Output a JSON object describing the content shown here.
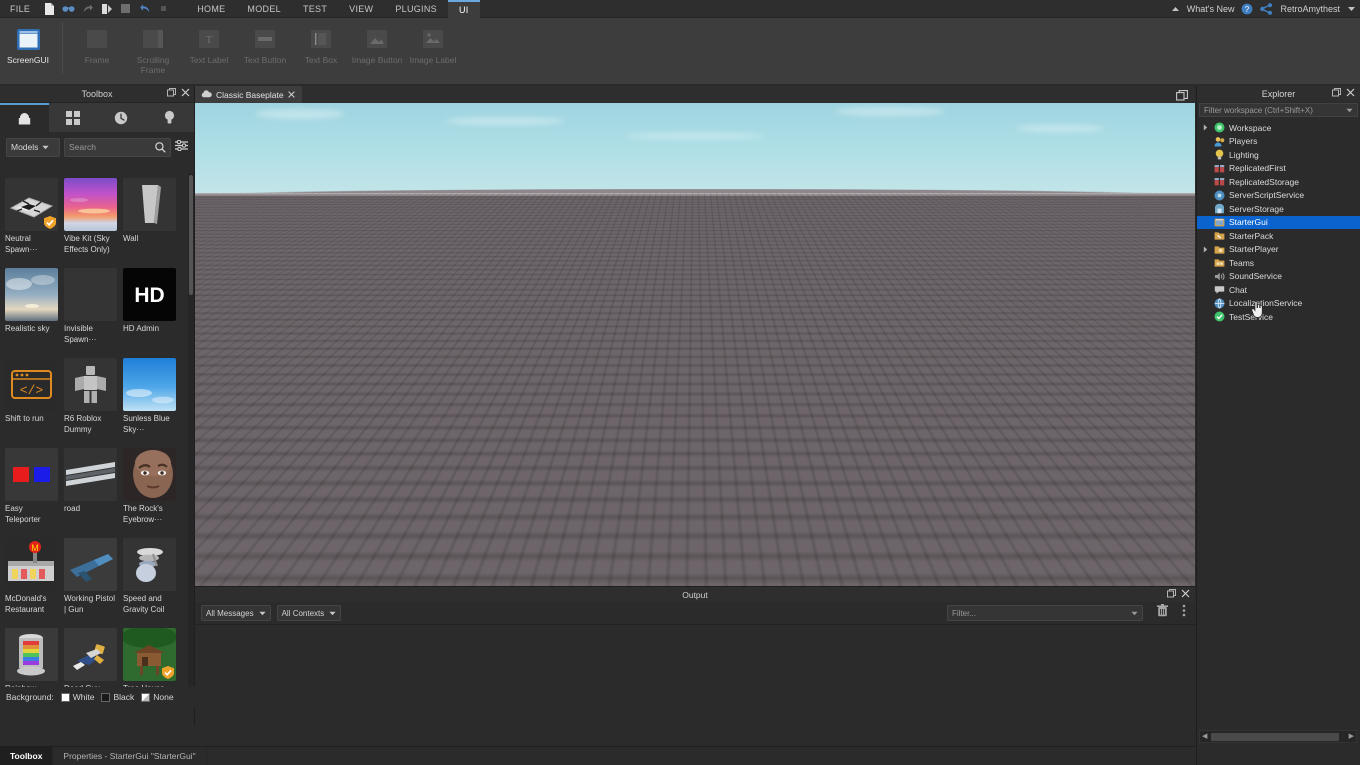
{
  "app": {
    "menu_file": "FILE",
    "ribbon_tabs": [
      {
        "label": "HOME",
        "active": false
      },
      {
        "label": "MODEL",
        "active": false
      },
      {
        "label": "TEST",
        "active": false
      },
      {
        "label": "VIEW",
        "active": false
      },
      {
        "label": "PLUGINS",
        "active": false
      },
      {
        "label": "UI",
        "active": true
      }
    ],
    "quick_access": [
      "new-file-icon",
      "find-icon",
      "redo-arrow-icon",
      "run-icon",
      "stop-icon",
      "undo-icon",
      "overflow-icon"
    ],
    "topright": {
      "collapse_icon": "chevron-up-icon",
      "whats_new": "What's New",
      "help_icon": "help-circle-icon",
      "share_icon": "share-icon",
      "username": "RetroAmythest",
      "dropdown_icon": "chevron-down-icon"
    }
  },
  "ribbon": {
    "items": [
      {
        "label": "ScreenGUI",
        "icon": "screengui-icon",
        "enabled": true
      },
      {
        "label": "Frame",
        "icon": "frame-icon",
        "enabled": false
      },
      {
        "label": "Scrolling Frame",
        "icon": "scrolling-frame-icon",
        "enabled": false
      },
      {
        "label": "Text Label",
        "icon": "text-label-icon",
        "enabled": false
      },
      {
        "label": "Text Button",
        "icon": "text-button-icon",
        "enabled": false
      },
      {
        "label": "Text Box",
        "icon": "text-box-icon",
        "enabled": false
      },
      {
        "label": "Image Button",
        "icon": "image-button-icon",
        "enabled": false
      },
      {
        "label": "Image Label",
        "icon": "image-label-icon",
        "enabled": false
      }
    ]
  },
  "toolbox": {
    "title": "Toolbox",
    "tabs": [
      {
        "icon": "marketplace-icon",
        "active": true
      },
      {
        "icon": "grid-icon",
        "active": false
      },
      {
        "icon": "clock-icon",
        "active": false
      },
      {
        "icon": "lightbulb-icon",
        "active": false
      }
    ],
    "category": "Models",
    "search_placeholder": "Search",
    "items": [
      {
        "name": "Neutral Spawn···",
        "thumb": "spawn-pad",
        "verified": true
      },
      {
        "name": "Vibe Kit (Sky Effects Only)",
        "thumb": "sunset-sky",
        "verified": false
      },
      {
        "name": "Wall",
        "thumb": "gray-wall",
        "verified": false
      },
      {
        "name": "Realistic sky",
        "thumb": "cloud-sky",
        "verified": false
      },
      {
        "name": "Invisible Spawn···",
        "thumb": "blank",
        "verified": false
      },
      {
        "name": "HD Admin",
        "thumb": "hd-logo",
        "verified": false
      },
      {
        "name": "Shift to run",
        "thumb": "code-window",
        "verified": false
      },
      {
        "name": "R6 Roblox Dummy",
        "thumb": "dummy-figure",
        "verified": false
      },
      {
        "name": "Sunless Blue Sky···",
        "thumb": "blue-sky",
        "verified": false
      },
      {
        "name": "Easy Teleporter",
        "thumb": "two-pads",
        "verified": false
      },
      {
        "name": "road",
        "thumb": "road-strip",
        "verified": false
      },
      {
        "name": "The Rock's Eyebrow···",
        "thumb": "face-photo",
        "verified": false
      },
      {
        "name": "McDonald's Restaurant",
        "thumb": "mcdonalds-build",
        "verified": false
      },
      {
        "name": "Working Pistol | Gun",
        "thumb": "pistol",
        "verified": false
      },
      {
        "name": "Speed and Gravity Coil",
        "thumb": "coils",
        "verified": false
      },
      {
        "name": "Rainbow Magic···",
        "thumb": "rainbow-pillar",
        "verified": false
      },
      {
        "name": "Dead Guy",
        "thumb": "ragdoll",
        "verified": false
      },
      {
        "name": "Tree House",
        "thumb": "treehouse",
        "verified": true
      }
    ],
    "background_label": "Background:",
    "background_options": [
      {
        "label": "White",
        "swatch": "#ffffff"
      },
      {
        "label": "Black",
        "swatch": "#1a1a1a"
      },
      {
        "label": "None",
        "swatch": "#cccccc"
      }
    ]
  },
  "dockbar": {
    "tabs": [
      {
        "label": "Toolbox",
        "active": true
      },
      {
        "label": "Properties - StarterGui \"StarterGui\"",
        "active": false
      }
    ]
  },
  "viewport": {
    "tab_label": "Classic Baseplate",
    "tab_icon": "place-cloud-icon",
    "close_icon": "close-icon",
    "restore_icon": "restore-window-icon",
    "sky_color": "#aadde6",
    "ground_color": "#6d6569"
  },
  "output": {
    "title": "Output",
    "message_filter": "All Messages",
    "context_filter": "All Contexts",
    "filter_placeholder": "Filter...",
    "clear_icon": "trash-icon",
    "menu_icon": "kebab-menu-icon",
    "float_icon": "float-window-icon",
    "close_icon": "close-icon"
  },
  "explorer": {
    "title": "Explorer",
    "float_icon": "float-window-icon",
    "close_icon": "close-icon",
    "filter_placeholder": "Filter workspace (Ctrl+Shift+X)",
    "items": [
      {
        "label": "Workspace",
        "icon": "workspace-icon",
        "color": "#3fc46b",
        "expandable": true,
        "indent": 0,
        "selected": false
      },
      {
        "label": "Players",
        "icon": "players-icon",
        "color": "#4a9ad4",
        "expandable": false,
        "indent": 1,
        "selected": false
      },
      {
        "label": "Lighting",
        "icon": "lighting-icon",
        "color": "#e5c44c",
        "expandable": false,
        "indent": 1,
        "selected": false
      },
      {
        "label": "ReplicatedFirst",
        "icon": "replicated-first-icon",
        "color": "#c0504d",
        "expandable": false,
        "indent": 1,
        "selected": false
      },
      {
        "label": "ReplicatedStorage",
        "icon": "replicated-storage-icon",
        "color": "#c0504d",
        "expandable": false,
        "indent": 1,
        "selected": false
      },
      {
        "label": "ServerScriptService",
        "icon": "server-script-icon",
        "color": "#4f8fc0",
        "expandable": false,
        "indent": 1,
        "selected": false
      },
      {
        "label": "ServerStorage",
        "icon": "server-storage-icon",
        "color": "#6fa8c8",
        "expandable": false,
        "indent": 1,
        "selected": false
      },
      {
        "label": "StarterGui",
        "icon": "starter-gui-icon",
        "color": "#d6a44a",
        "expandable": false,
        "indent": 1,
        "selected": true
      },
      {
        "label": "StarterPack",
        "icon": "starter-pack-icon",
        "color": "#d6a44a",
        "expandable": false,
        "indent": 1,
        "selected": false
      },
      {
        "label": "StarterPlayer",
        "icon": "starter-player-icon",
        "color": "#d6a44a",
        "expandable": true,
        "indent": 0,
        "selected": false
      },
      {
        "label": "Teams",
        "icon": "teams-icon",
        "color": "#d6a44a",
        "expandable": false,
        "indent": 1,
        "selected": false
      },
      {
        "label": "SoundService",
        "icon": "sound-service-icon",
        "color": "#9a9a9a",
        "expandable": false,
        "indent": 1,
        "selected": false
      },
      {
        "label": "Chat",
        "icon": "chat-icon",
        "color": "#c9c9c9",
        "expandable": false,
        "indent": 1,
        "selected": false
      },
      {
        "label": "LocalizationService",
        "icon": "localization-icon",
        "color": "#4f8fc0",
        "expandable": false,
        "indent": 1,
        "selected": false
      },
      {
        "label": "TestService",
        "icon": "test-service-icon",
        "color": "#3fc46b",
        "expandable": false,
        "indent": 1,
        "selected": false
      }
    ]
  }
}
